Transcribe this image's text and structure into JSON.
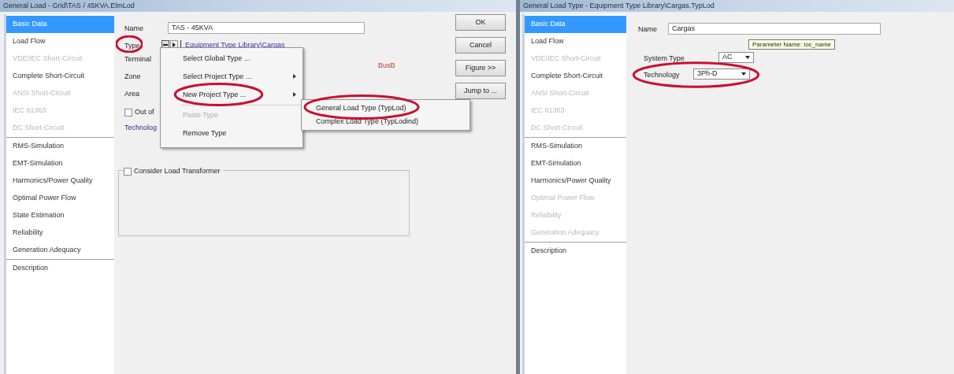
{
  "left_window": {
    "title": "General Load - Grid\\TAS / 45KVA.ElmLod",
    "sidebar": [
      {
        "label": "Basic Data",
        "selected": true,
        "disabled": false
      },
      {
        "label": "Load Flow",
        "selected": false,
        "disabled": false
      },
      {
        "label": "VDE/IEC Short-Circuit",
        "selected": false,
        "disabled": true
      },
      {
        "label": "Complete Short-Circuit",
        "selected": false,
        "disabled": false
      },
      {
        "label": "ANSI Short-Circuit",
        "selected": false,
        "disabled": true
      },
      {
        "label": "IEC 61363",
        "selected": false,
        "disabled": true
      },
      {
        "label": "DC Short-Circuit",
        "selected": false,
        "disabled": true
      },
      {
        "label": "RMS-Simulation",
        "selected": false,
        "disabled": false
      },
      {
        "label": "EMT-Simulation",
        "selected": false,
        "disabled": false
      },
      {
        "label": "Harmonics/Power Quality",
        "selected": false,
        "disabled": false
      },
      {
        "label": "Optimal Power Flow",
        "selected": false,
        "disabled": false
      },
      {
        "label": "State Estimation",
        "selected": false,
        "disabled": false
      },
      {
        "label": "Reliability",
        "selected": false,
        "disabled": false
      },
      {
        "label": "Generation Adequacy",
        "selected": false,
        "disabled": false
      },
      {
        "label": "Description",
        "selected": false,
        "disabled": false
      }
    ],
    "name": {
      "label": "Name",
      "value": "TAS - 45KVA"
    },
    "type": {
      "label": "Type",
      "circled": true,
      "link": "Equipment Type Library\\Cargas"
    },
    "terminal": {
      "label": "Terminal",
      "value": "BusB"
    },
    "zone": {
      "label": "Zone"
    },
    "area": {
      "label": "Area"
    },
    "out_of_service": {
      "label": "Out of",
      "checked": false
    },
    "technology": {
      "label": "Technolog"
    },
    "consider_load_transformer": {
      "label": "Consider Load Transformer",
      "checked": false
    },
    "buttons": [
      "OK",
      "Cancel",
      "Figure >>",
      "Jump to ..."
    ],
    "context_menu": [
      {
        "label": "Select Global Type ...",
        "disabled": false,
        "has_submenu": false,
        "circled": false
      },
      {
        "label": "Select Project Type ...",
        "disabled": false,
        "has_submenu": true,
        "circled": false
      },
      {
        "label": "New Project Type ...",
        "disabled": false,
        "has_submenu": true,
        "circled": true
      },
      {
        "label": "Paste Type",
        "disabled": true,
        "has_submenu": false,
        "circled": false
      },
      {
        "label": "Remove Type",
        "disabled": false,
        "has_submenu": false,
        "circled": false
      }
    ],
    "submenu": [
      {
        "label": "General Load Type (TypLod)",
        "circled": true
      },
      {
        "label": "Complex Load Type (TypLodind)",
        "circled": false
      }
    ]
  },
  "right_window": {
    "title": "General Load Type - Equipment Type Library\\Cargas.TypLod",
    "sidebar": [
      {
        "label": "Basic Data",
        "selected": true,
        "disabled": false
      },
      {
        "label": "Load Flow",
        "selected": false,
        "disabled": false
      },
      {
        "label": "VDE/IEC Short-Circuit",
        "selected": false,
        "disabled": true
      },
      {
        "label": "Complete Short-Circuit",
        "selected": false,
        "disabled": false
      },
      {
        "label": "ANSI Short-Circuit",
        "selected": false,
        "disabled": true
      },
      {
        "label": "IEC 61363",
        "selected": false,
        "disabled": true
      },
      {
        "label": "DC Short-Circuit",
        "selected": false,
        "disabled": true
      },
      {
        "label": "RMS-Simulation",
        "selected": false,
        "disabled": false
      },
      {
        "label": "EMT-Simulation",
        "selected": false,
        "disabled": false
      },
      {
        "label": "Harmonics/Power Quality",
        "selected": false,
        "disabled": false
      },
      {
        "label": "Optimal Power Flow",
        "selected": false,
        "disabled": true
      },
      {
        "label": "Reliability",
        "selected": false,
        "disabled": true
      },
      {
        "label": "Generation Adequacy",
        "selected": false,
        "disabled": true
      },
      {
        "label": "Description",
        "selected": false,
        "disabled": false
      }
    ],
    "name": {
      "label": "Name",
      "value": "Cargas"
    },
    "tooltip": "Parameter Name: loc_name",
    "system_type": {
      "label": "System Type",
      "value": "AC"
    },
    "technology": {
      "label": "Technology",
      "value": "3Ph-D",
      "circled": true
    }
  }
}
